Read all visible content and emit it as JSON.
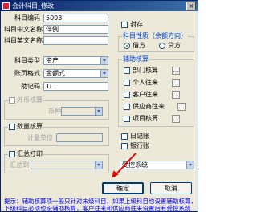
{
  "window": {
    "title": "会计科目_修改"
  },
  "form": {
    "code_label": "科目编码",
    "code_value": "5003",
    "cn_name_label": "科目中文名称",
    "cn_name_value": "伴例",
    "en_name_label": "科目英文名称",
    "en_name_value": "",
    "type_label": "科目类型",
    "type_value": "资产",
    "format_label": "账页格式",
    "format_value": "金额式",
    "mnemonic_label": "助记码",
    "mnemonic_value": "TL"
  },
  "foreign": {
    "title": "外币核算",
    "currency_label": "币种",
    "currency_value": ""
  },
  "quantity": {
    "title": "数量核算",
    "unit_label": "计量单位",
    "unit_value": ""
  },
  "summary": {
    "title": "汇总打印",
    "to_label": "汇总到",
    "to_value": ""
  },
  "sealed_label": "封存",
  "nature": {
    "title": "科目性质（余额方向）",
    "debit": "借方",
    "credit": "贷方",
    "selected": "借方"
  },
  "aux": {
    "title": "辅助核算",
    "items": [
      "部门核算",
      "个人往来",
      "客户往来",
      "供应商往来",
      "项目核算"
    ]
  },
  "journal": {
    "daily": "日记账",
    "bank": "银行账"
  },
  "system_select": {
    "value": "受控系统"
  },
  "buttons": {
    "ok": "确定",
    "cancel": "取消"
  },
  "tip": {
    "line1": "提示：辅助核算项一般只针对末级科目，如果上级科目也设置辅助核算，",
    "line2": "下级科目必须也设辅助核算，客户往来和供应商往来设置后有受控系统"
  }
}
